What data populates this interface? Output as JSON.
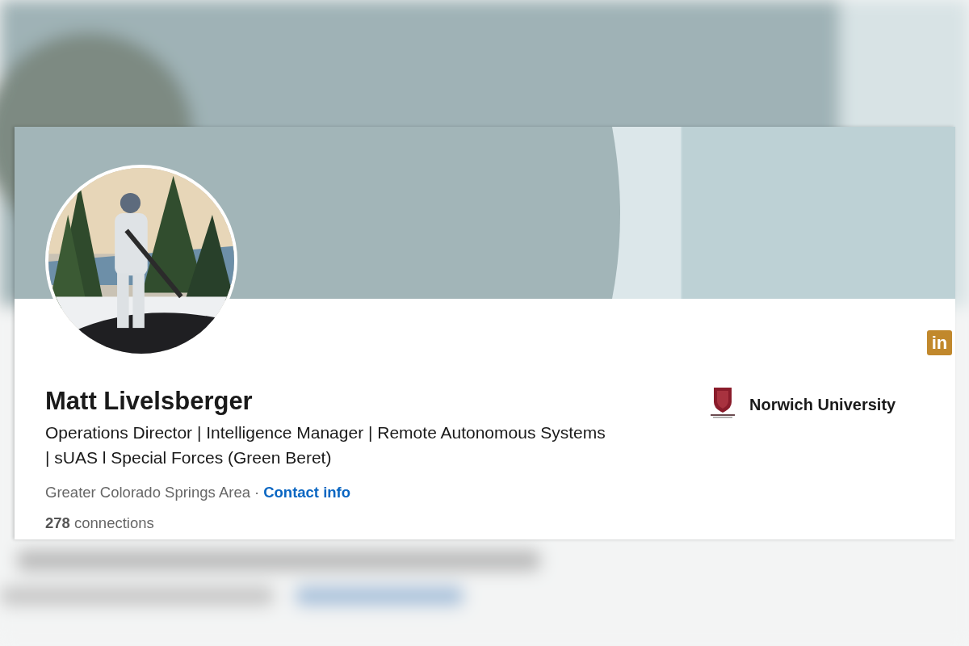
{
  "profile": {
    "name": "Matt Livelsberger",
    "headline": "Operations Director | Intelligence Manager | Remote Autonomous Systems | sUAS l Special Forces (Green Beret)",
    "location": "Greater Colorado Springs Area",
    "separator": "·",
    "contact_link": "Contact info",
    "connections_count": "278",
    "connections_label": "connections",
    "education": "Norwich University",
    "brand_badge": "in"
  }
}
